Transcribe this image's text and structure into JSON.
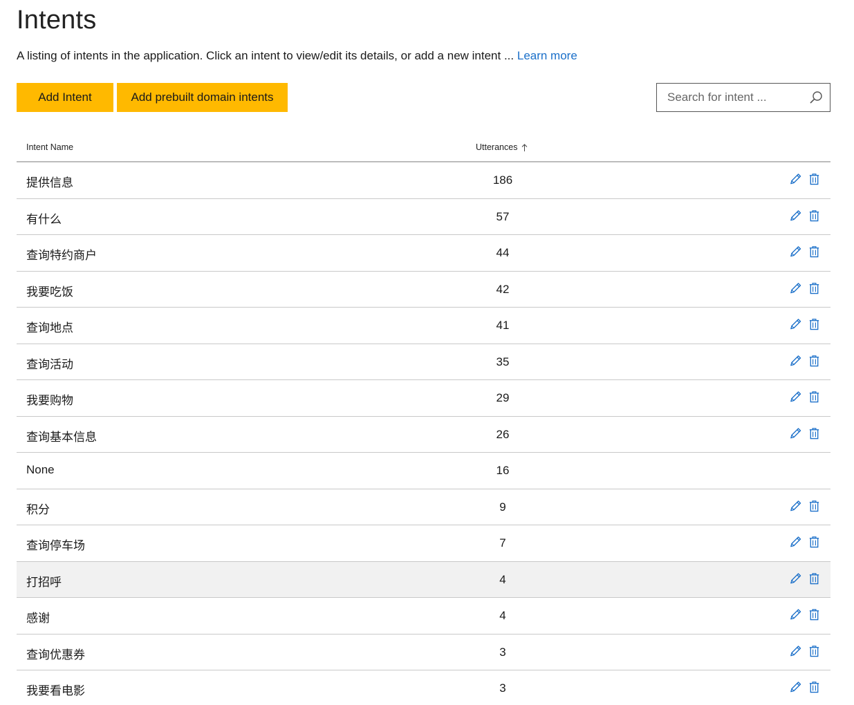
{
  "header": {
    "title": "Intents",
    "description": "A listing of intents in the application. Click an intent to view/edit its details, or add a new intent ... ",
    "learn_more": "Learn more"
  },
  "toolbar": {
    "add_intent": "Add Intent",
    "add_prebuilt": "Add prebuilt domain intents",
    "search_placeholder": "Search for intent ..."
  },
  "table": {
    "columns": {
      "name": "Intent Name",
      "utterances": "Utterances"
    },
    "rows": [
      {
        "name": "提供信息",
        "utterances": "186",
        "editable": true
      },
      {
        "name": "有什么",
        "utterances": "57",
        "editable": true
      },
      {
        "name": "查询特约商户",
        "utterances": "44",
        "editable": true
      },
      {
        "name": "我要吃饭",
        "utterances": "42",
        "editable": true
      },
      {
        "name": "查询地点",
        "utterances": "41",
        "editable": true
      },
      {
        "name": "查询活动",
        "utterances": "35",
        "editable": true
      },
      {
        "name": "我要购物",
        "utterances": "29",
        "editable": true
      },
      {
        "name": "查询基本信息",
        "utterances": "26",
        "editable": true
      },
      {
        "name": "None",
        "utterances": "16",
        "editable": false
      },
      {
        "name": "积分",
        "utterances": "9",
        "editable": true
      },
      {
        "name": "查询停车场",
        "utterances": "7",
        "editable": true
      },
      {
        "name": "打招呼",
        "utterances": "4",
        "editable": true,
        "highlighted": true
      },
      {
        "name": "感谢",
        "utterances": "4",
        "editable": true
      },
      {
        "name": "查询优惠券",
        "utterances": "3",
        "editable": true
      },
      {
        "name": "我要看电影",
        "utterances": "3",
        "editable": true
      }
    ]
  },
  "colors": {
    "accent_button": "#ffb900",
    "link": "#1a6fc9",
    "icon": "#1a6fc9"
  },
  "icons": {
    "search": "search-icon",
    "sort": "arrow-up-icon",
    "edit": "pencil-icon",
    "delete": "trash-icon"
  }
}
